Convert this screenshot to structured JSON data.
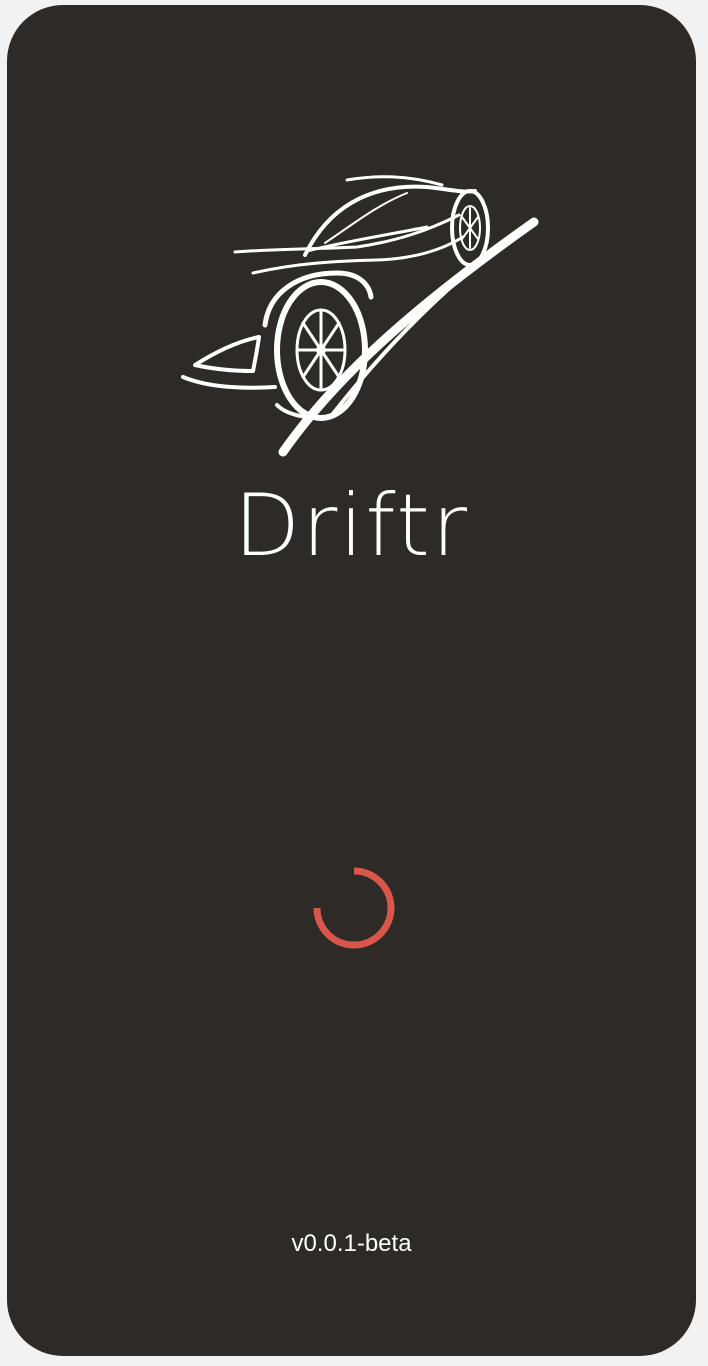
{
  "app": {
    "title": "Driftr",
    "version": "v0.0.1-beta",
    "logo_icon": "sports-car-icon"
  },
  "loader": {
    "icon": "loading-spinner-icon",
    "status": "loading"
  },
  "colors": {
    "background": "#2d2a27",
    "page": "#f2f2f2",
    "text": "#ffffff",
    "accent": "#d9574a"
  }
}
